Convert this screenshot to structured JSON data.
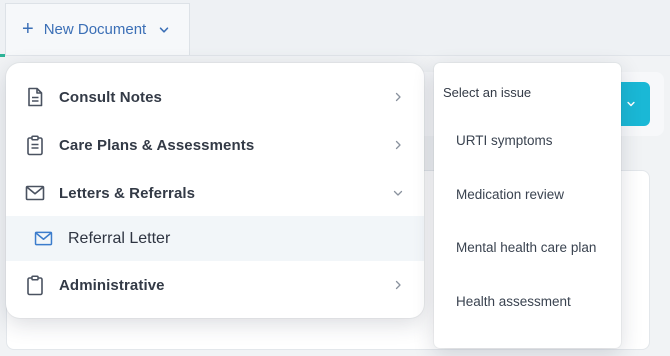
{
  "toolbar": {
    "new_document_label": "New Document",
    "plus_icon": "+"
  },
  "menu": {
    "items": [
      {
        "label": "Consult Notes",
        "icon": "document-icon",
        "arrow": "chevron-right"
      },
      {
        "label": "Care Plans & Assessments",
        "icon": "clipboard-list-icon",
        "arrow": "chevron-right"
      },
      {
        "label": "Letters & Referrals",
        "icon": "envelope-icon",
        "arrow": "chevron-down",
        "expanded": true
      },
      {
        "label": "Administrative",
        "icon": "clipboard-icon",
        "arrow": "chevron-right"
      }
    ],
    "subitem": {
      "label": "Referral Letter",
      "icon": "envelope-icon"
    }
  },
  "issue_menu": {
    "header": "Select an issue",
    "options": [
      "URTI symptoms",
      "Medication review",
      "Mental health care plan",
      "Health assessment"
    ]
  },
  "colors": {
    "accent_blue": "#3b6fb6",
    "teal": "#1ab8d6",
    "green_accent": "#2eb398"
  }
}
